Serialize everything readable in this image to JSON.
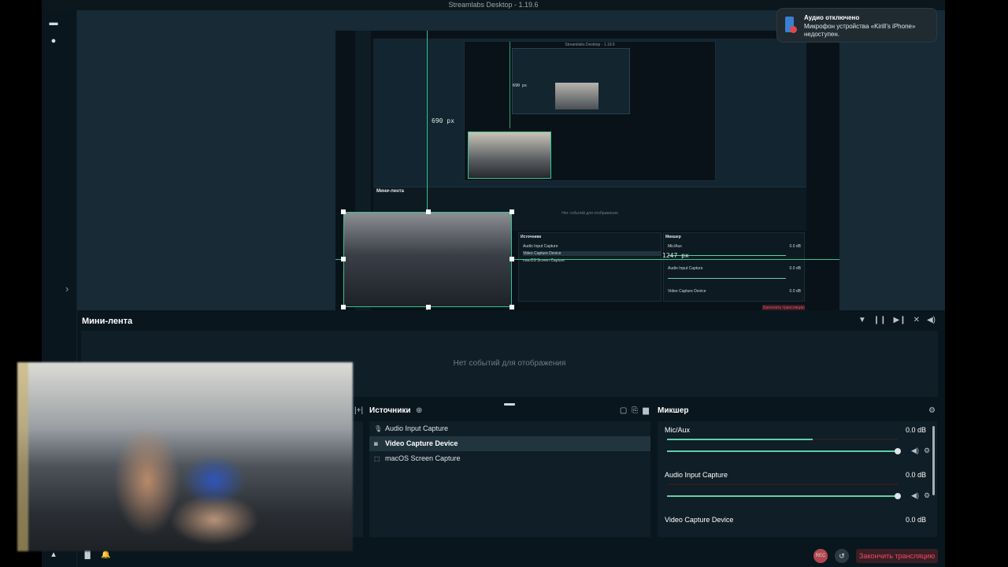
{
  "window": {
    "title": "Streamlabs Desktop - 1.19.6"
  },
  "nav": {
    "items": [
      "studio-mode",
      "record"
    ]
  },
  "editor": {
    "ruler_vertical": "690 px",
    "ruler_horizontal": "1247 px",
    "nested_ruler": "690 px",
    "nested": {
      "title": "Streamlabs Desktop - 1.19.6",
      "minifeed_title": "Мини-лента",
      "minifeed_empty": "Нет событий для отображения",
      "sources_title": "Источники",
      "sources": [
        "Audio Input Capture",
        "Video Capture Device",
        "macOS Screen Capture"
      ],
      "mixer_title": "Микшер",
      "tracks": [
        {
          "name": "Mic/Aux",
          "db": "0.0 dB"
        },
        {
          "name": "Audio Input Capture",
          "db": "0.0 dB"
        },
        {
          "name": "Video Capture Device",
          "db": "0.0 dB"
        }
      ],
      "end_label": "Закончить трансляцию"
    }
  },
  "minifeed": {
    "title": "Мини-лента",
    "empty_text": "Нет событий для отображения"
  },
  "sources": {
    "title": "Источники",
    "items": [
      {
        "label": "Audio Input Capture",
        "icon": "mic-icon",
        "selected": false
      },
      {
        "label": "Video Capture Device",
        "icon": "camera-icon",
        "selected": true
      },
      {
        "label": "macOS Screen Capture",
        "icon": "screen-icon",
        "selected": false
      }
    ]
  },
  "mixer": {
    "title": "Микшер",
    "tracks": [
      {
        "name": "Mic/Aux",
        "db": "0.0 dB",
        "level": 0.63,
        "volume": 1.0
      },
      {
        "name": "Audio Input Capture",
        "db": "0.0 dB",
        "level": 0.0,
        "volume": 1.0
      },
      {
        "name": "Video Capture Device",
        "db": "0.0 dB",
        "level": 0.0,
        "volume": 1.0
      }
    ]
  },
  "footer": {
    "rec_label": "REC",
    "end_stream_label": "Закончить трансляцию"
  },
  "notification": {
    "title": "Аудио отключено",
    "message": "Микрофон устройства «Kirill’s iPhone» недоступен."
  },
  "colors": {
    "accent": "#31c48d",
    "danger": "#f04b5b",
    "background": "#09161e"
  }
}
